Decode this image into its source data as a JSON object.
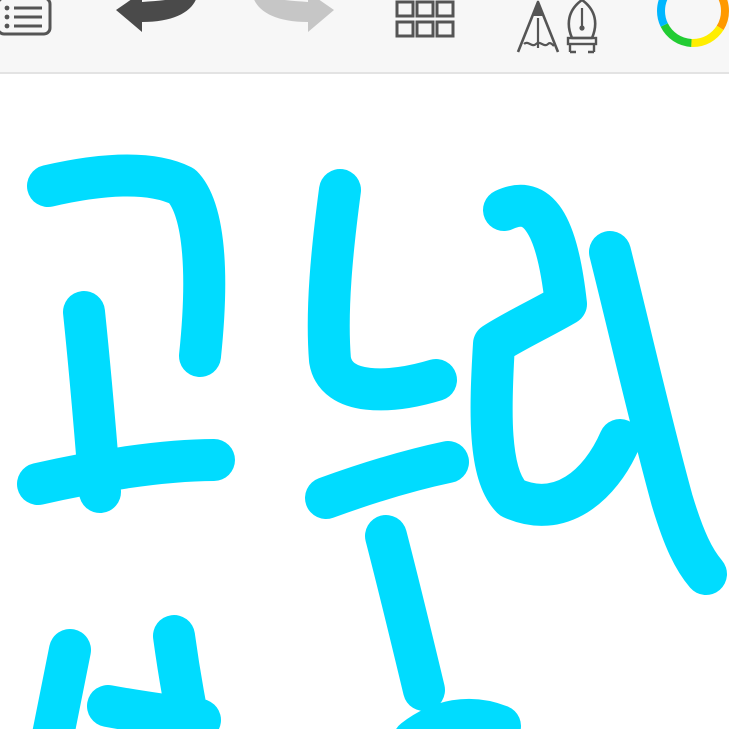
{
  "toolbar": {
    "tools": [
      {
        "icon": "list-menu-icon"
      },
      {
        "icon": "undo-arrow-icon"
      },
      {
        "icon": "redo-arrow-icon"
      },
      {
        "icon": "grid-gallery-icon"
      },
      {
        "icon": "pencil-pen-brush-icon"
      },
      {
        "icon": "color-wheel-icon"
      }
    ]
  },
  "canvas": {
    "brush_color": "#00dcff",
    "background_color": "#ffffff",
    "strokes_count_label": ""
  }
}
